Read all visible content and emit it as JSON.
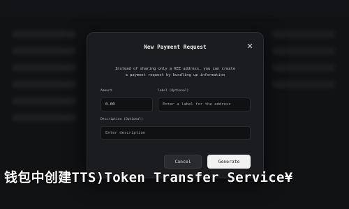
{
  "dialog": {
    "title": "New Payment Request",
    "description_line1": "Instead of sharing only a KEE address, you can create",
    "description_line2": "a payment request by bundling up information",
    "amount": {
      "label": "Amount",
      "value": "0.00"
    },
    "label_field": {
      "label": "label (Optional)",
      "placeholder": "Enter a label for the address"
    },
    "description_field": {
      "label": "Description (Optional)",
      "placeholder": "Enter description"
    },
    "cancel_label": "Cancel",
    "generate_label": "Generate"
  },
  "caption": "钱包中创建TTS)Token Transfer Service¥"
}
